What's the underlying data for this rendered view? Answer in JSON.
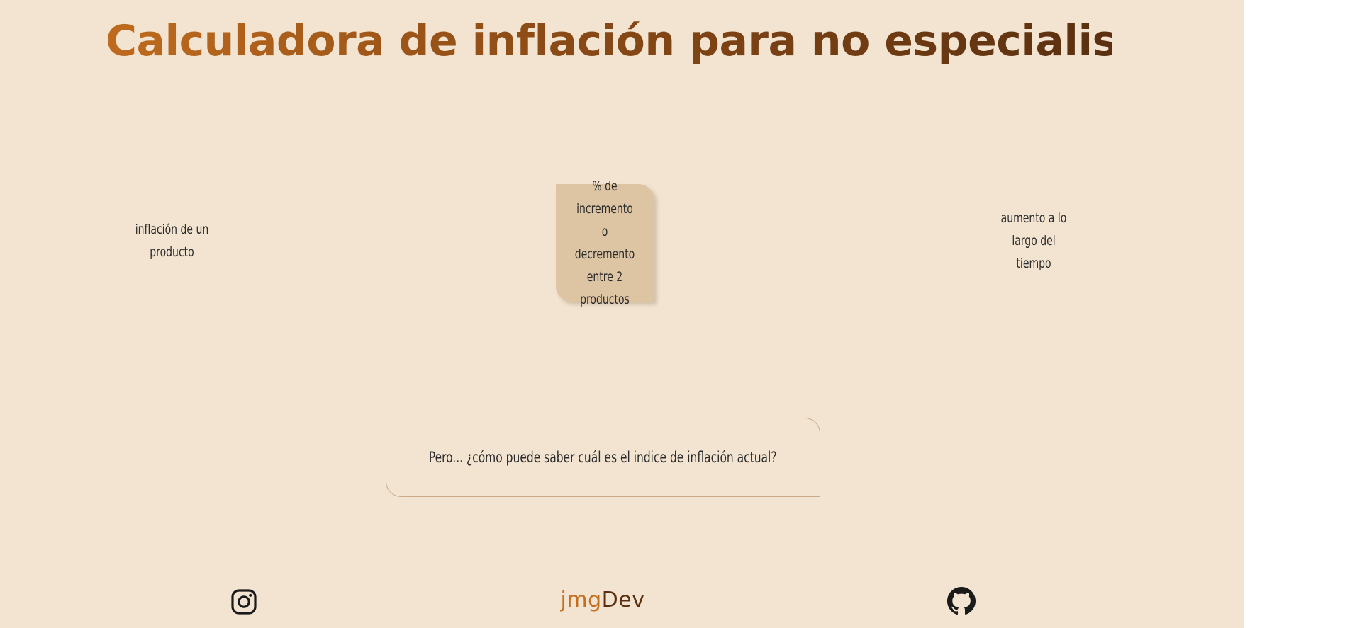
{
  "header": {
    "title": "Calculadora de inflación para no especialistas"
  },
  "options": [
    {
      "label": "inflación de un producto"
    },
    {
      "label": "% de incremento o decremento entre 2 productos"
    },
    {
      "label": "aumento a lo largo del tiempo"
    }
  ],
  "question": {
    "text": "Pero... ¿cómo puede saber cuál es el indice de inflación actual?"
  },
  "footer": {
    "brand_part1": "jmg",
    "brand_part2": "Dev",
    "left_icon": "instagram-icon",
    "right_icon": "github-icon"
  },
  "colors": {
    "background": "#f2e4d1",
    "accent": "#c46f1f",
    "accent_dark": "#5a3010",
    "selected_card": "#ddc5a4"
  }
}
